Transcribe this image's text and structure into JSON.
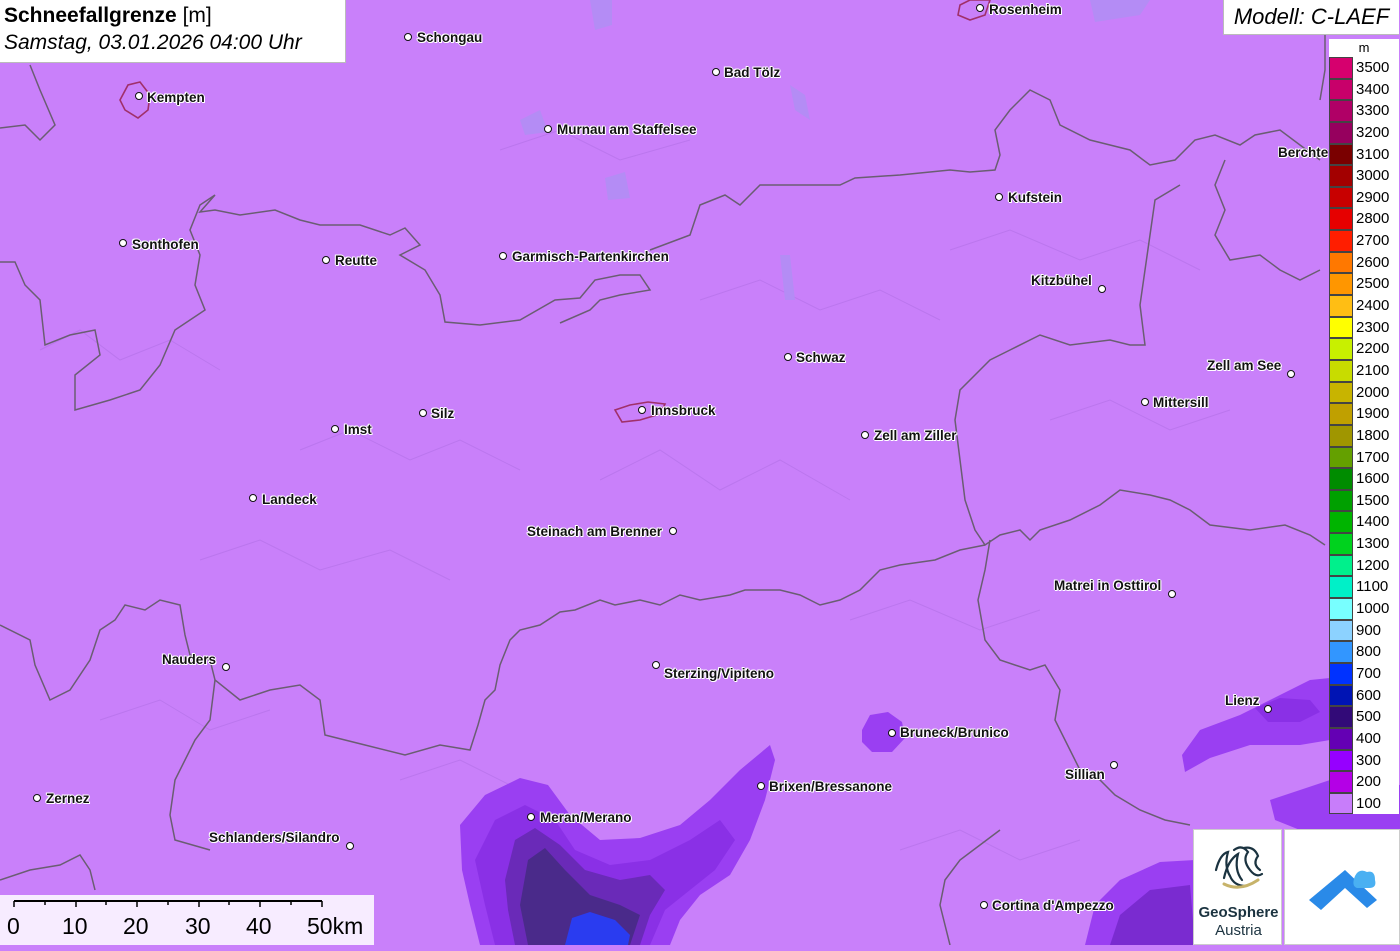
{
  "title": {
    "main": "Schneefallgrenze",
    "unit": "[m]",
    "datetime": "Samstag, 03.01.2026 04:00 Uhr"
  },
  "model": "Modell: C-LAEF",
  "legend": {
    "unit": "m",
    "entries": [
      {
        "label": "3500",
        "color": "#d6006e"
      },
      {
        "label": "3400",
        "color": "#c8006a"
      },
      {
        "label": "3300",
        "color": "#b00066"
      },
      {
        "label": "3200",
        "color": "#96005e"
      },
      {
        "label": "3100",
        "color": "#7a0000"
      },
      {
        "label": "3000",
        "color": "#a30000"
      },
      {
        "label": "2900",
        "color": "#c80000"
      },
      {
        "label": "2800",
        "color": "#e60000"
      },
      {
        "label": "2700",
        "color": "#ff1e00"
      },
      {
        "label": "2600",
        "color": "#ff7800"
      },
      {
        "label": "2500",
        "color": "#ff9600"
      },
      {
        "label": "2400",
        "color": "#ffbe14"
      },
      {
        "label": "2300",
        "color": "#ffff00"
      },
      {
        "label": "2200",
        "color": "#c8f000"
      },
      {
        "label": "2100",
        "color": "#c8dc00"
      },
      {
        "label": "2000",
        "color": "#c8b400"
      },
      {
        "label": "1900",
        "color": "#c0a000"
      },
      {
        "label": "1800",
        "color": "#a09600"
      },
      {
        "label": "1700",
        "color": "#64a000"
      },
      {
        "label": "1600",
        "color": "#008c00"
      },
      {
        "label": "1500",
        "color": "#00a000"
      },
      {
        "label": "1400",
        "color": "#00b400"
      },
      {
        "label": "1300",
        "color": "#00d21e"
      },
      {
        "label": "1200",
        "color": "#00f08c"
      },
      {
        "label": "1100",
        "color": "#00f0c8"
      },
      {
        "label": "1000",
        "color": "#78ffff"
      },
      {
        "label": "900",
        "color": "#8cd2ff"
      },
      {
        "label": "800",
        "color": "#3296ff"
      },
      {
        "label": "700",
        "color": "#0032ff"
      },
      {
        "label": "600",
        "color": "#0014b4"
      },
      {
        "label": "500",
        "color": "#320a78"
      },
      {
        "label": "400",
        "color": "#6400b4"
      },
      {
        "label": "300",
        "color": "#9600ff"
      },
      {
        "label": "200",
        "color": "#b400e6"
      },
      {
        "label": "100",
        "color": "#c87dfa"
      }
    ]
  },
  "scale": {
    "labels": [
      "0",
      "10",
      "20",
      "30",
      "40",
      "50km"
    ]
  },
  "logos": {
    "geosphere_line1": "GeoSphere",
    "geosphere_line2": "Austria"
  },
  "colors": {
    "base": "#c980fa",
    "overlay_300": "#9a3ff2",
    "overlay_400": "#7a2bd0",
    "overlay_500": "#4a2a8a",
    "overlay_700": "#2a3cf0"
  },
  "cities": [
    {
      "name": "Rosenheim"
    },
    {
      "name": "Schongau"
    },
    {
      "name": "Bad Tölz"
    },
    {
      "name": "Kempten"
    },
    {
      "name": "Murnau am Staffelsee"
    },
    {
      "name": "Berchtesgaden"
    },
    {
      "name": "Kufstein"
    },
    {
      "name": "Sonthofen"
    },
    {
      "name": "Reutte"
    },
    {
      "name": "Garmisch-Partenkirchen"
    },
    {
      "name": "Kitzbühel"
    },
    {
      "name": "Schwaz"
    },
    {
      "name": "Zell am See"
    },
    {
      "name": "Mittersill"
    },
    {
      "name": "Imst"
    },
    {
      "name": "Silz"
    },
    {
      "name": "Innsbruck"
    },
    {
      "name": "Zell am Ziller"
    },
    {
      "name": "Landeck"
    },
    {
      "name": "Steinach am Brenner"
    },
    {
      "name": "Matrei in Osttirol"
    },
    {
      "name": "Nauders"
    },
    {
      "name": "Sterzing/Vipiteno"
    },
    {
      "name": "Lienz"
    },
    {
      "name": "Bruneck/Brunico"
    },
    {
      "name": "Sillian"
    },
    {
      "name": "Brixen/Bressanone"
    },
    {
      "name": "Zernez"
    },
    {
      "name": "Meran/Merano"
    },
    {
      "name": "Schlanders/Silandro"
    },
    {
      "name": "Cortina d'Ampezzo"
    }
  ]
}
